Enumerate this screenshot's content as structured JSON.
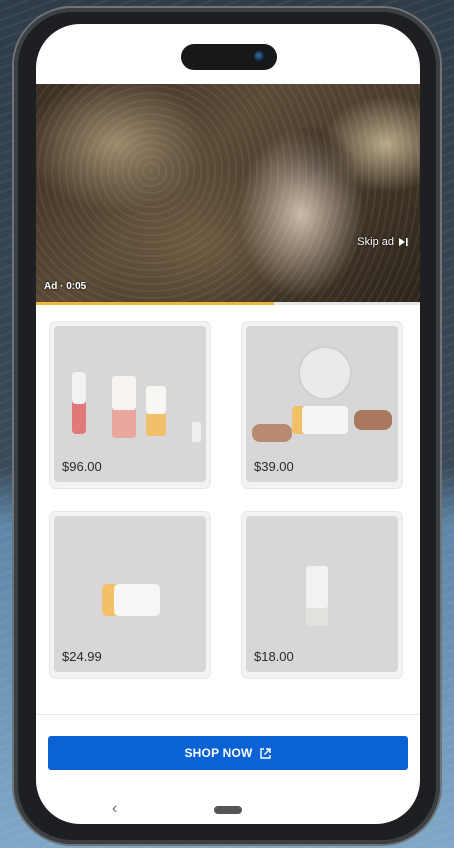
{
  "video_ad": {
    "ad_label": "Ad · 0:05",
    "skip_label": "Skip ad",
    "progress_fraction": 0.62
  },
  "products": [
    {
      "price": "$96.00",
      "name": "product-set-bottles"
    },
    {
      "price": "$39.00",
      "name": "product-jar-with-nuts"
    },
    {
      "price": "$24.99",
      "name": "product-small-jar"
    },
    {
      "price": "$18.00",
      "name": "product-dropper-bottle"
    }
  ],
  "cta": {
    "label": "SHOP NOW"
  },
  "colors": {
    "accent": "#0a62d4",
    "progress": "#f2b53b"
  }
}
